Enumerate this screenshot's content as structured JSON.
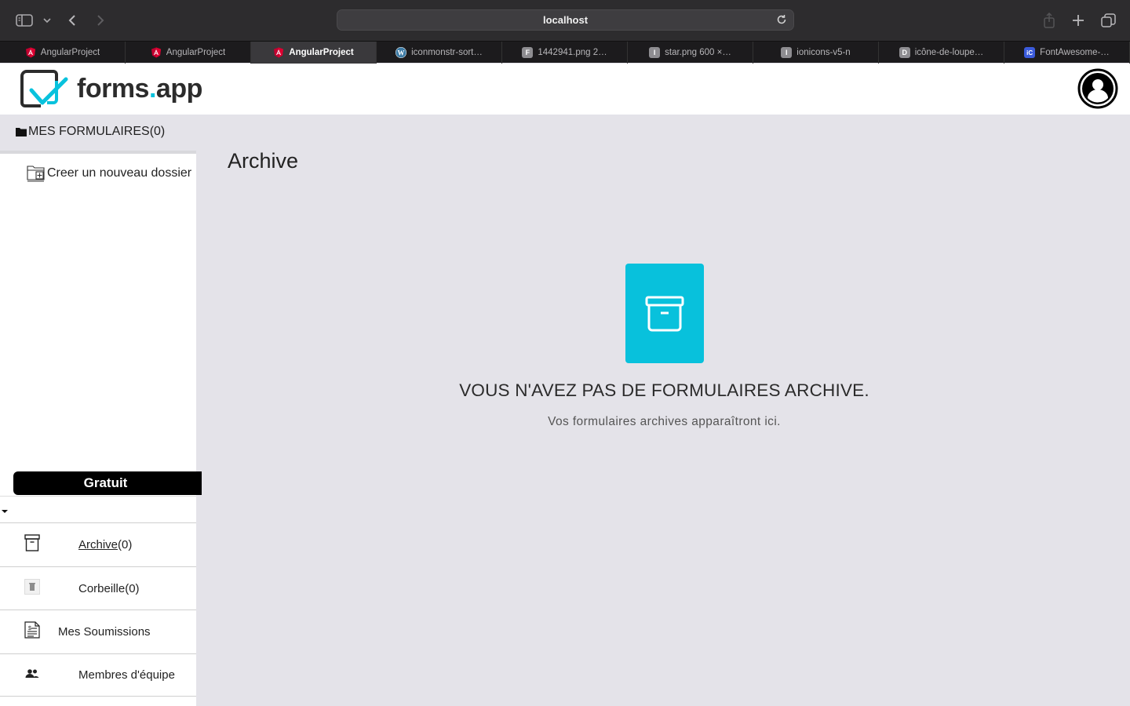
{
  "browser": {
    "url": "localhost",
    "tabs": [
      {
        "label": "AngularProject",
        "favicon": "angular-icon",
        "color": "#dd0031",
        "active": false
      },
      {
        "label": "AngularProject",
        "favicon": "angular-icon",
        "color": "#dd0031",
        "active": false
      },
      {
        "label": "AngularProject",
        "favicon": "angular-icon",
        "color": "#dd0031",
        "active": true
      },
      {
        "label": "iconmonstr-sort…",
        "favicon": "wordpress-icon",
        "color": "#3d7ba5",
        "active": false
      },
      {
        "label": "1442941.png 2…",
        "favicon": "letter-f-icon",
        "letter": "F",
        "color": "#8e8d91",
        "active": false
      },
      {
        "label": "star.png 600 ×…",
        "favicon": "letter-i-icon",
        "letter": "I",
        "color": "#8e8d91",
        "active": false
      },
      {
        "label": "ionicons-v5-n",
        "favicon": "letter-i-icon",
        "letter": "I",
        "color": "#8e8d91",
        "active": false
      },
      {
        "label": "icône-de-loupe…",
        "favicon": "letter-d-icon",
        "letter": "D",
        "color": "#8e8d91",
        "active": false
      },
      {
        "label": "FontAwesome-…",
        "favicon": "ic-icon",
        "letter": "iC",
        "color": "#3b5bdb",
        "active": false
      }
    ]
  },
  "header": {
    "logo_text_main": "forms",
    "logo_text_dot": ".",
    "logo_text_app": "app",
    "accent_color": "#08c2dd"
  },
  "sidebar": {
    "my_forms_label": "MES FORMULAIRES(0)",
    "new_folder_label": "Creer un nouveau dossier",
    "plan_label": "Gratuit",
    "items": [
      {
        "label": "Archive",
        "count": "(0)",
        "icon": "archive-icon"
      },
      {
        "label": "Corbeille(0)",
        "icon": "trash-icon"
      },
      {
        "label": "Mes Soumissions",
        "icon": "document-list-icon"
      },
      {
        "label": "Membres d'équipe",
        "icon": "team-icon"
      }
    ]
  },
  "main": {
    "title": "Archive",
    "empty_title": "VOUS N'AVEZ PAS DE FORMULAIRES ARCHIVE.",
    "empty_subtitle": "Vos formulaires archives apparaîtront ici.",
    "empty_icon": "archive-box-icon",
    "empty_icon_color": "#08c1dc"
  }
}
